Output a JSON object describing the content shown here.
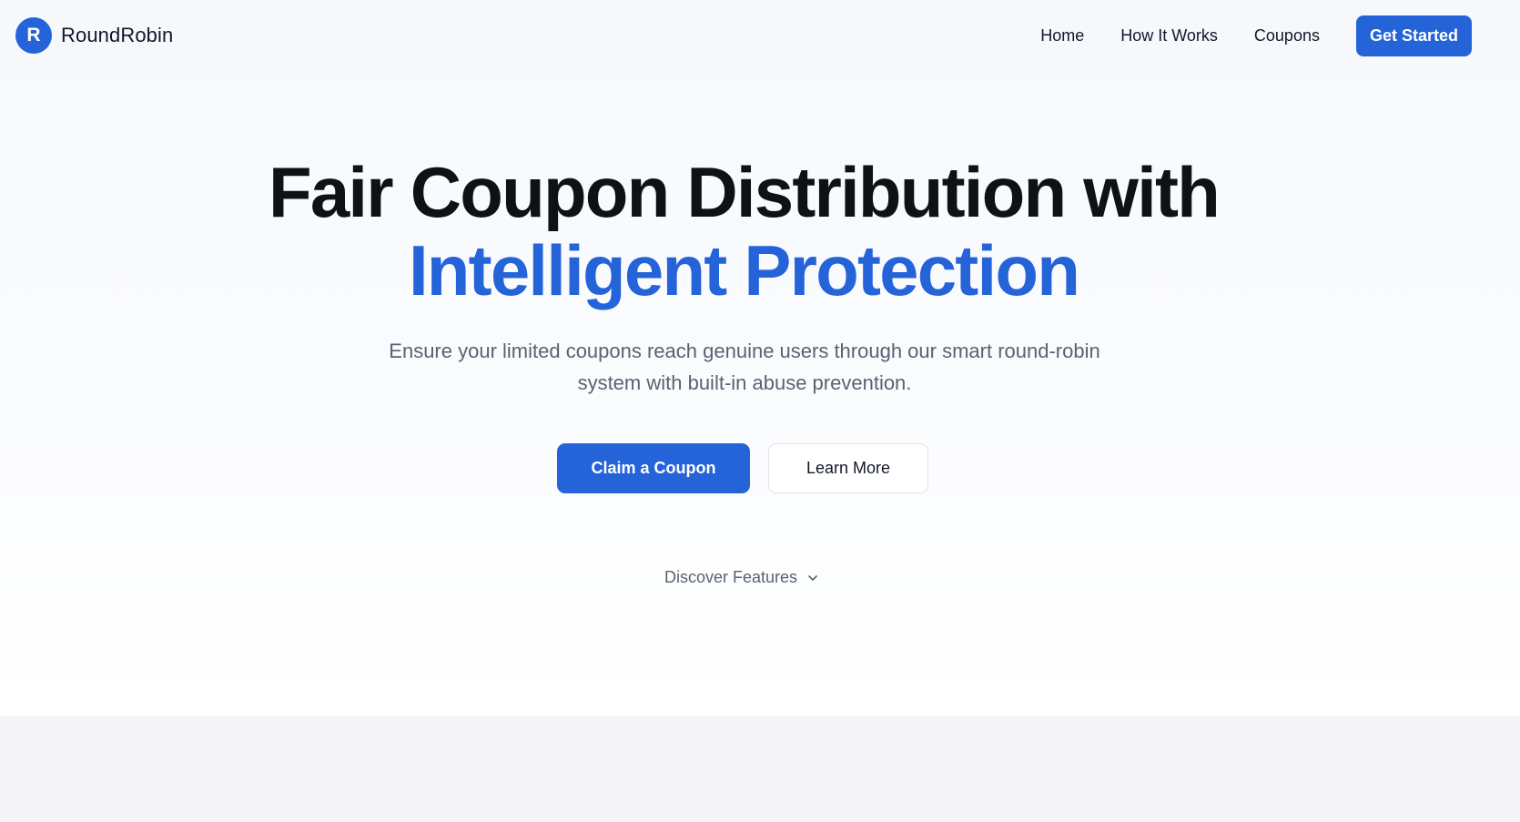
{
  "brand": {
    "logo_letter": "R",
    "name": "RoundRobin"
  },
  "nav": {
    "links": [
      "Home",
      "How It Works",
      "Coupons"
    ],
    "cta": "Get Started"
  },
  "hero": {
    "title_line1": "Fair Coupon Distribution with",
    "title_line2": "Intelligent Protection",
    "subtitle": "Ensure your limited coupons reach genuine users through our smart round-robin system with built-in abuse prevention.",
    "primary_button": "Claim a Coupon",
    "secondary_button": "Learn More",
    "discover_label": "Discover Features",
    "discover_icon": "chevron-down-icon"
  },
  "colors": {
    "accent": "#2563d9",
    "heading": "#0f1115",
    "muted": "#5b6170",
    "section_bg": "#f5f5f7"
  }
}
